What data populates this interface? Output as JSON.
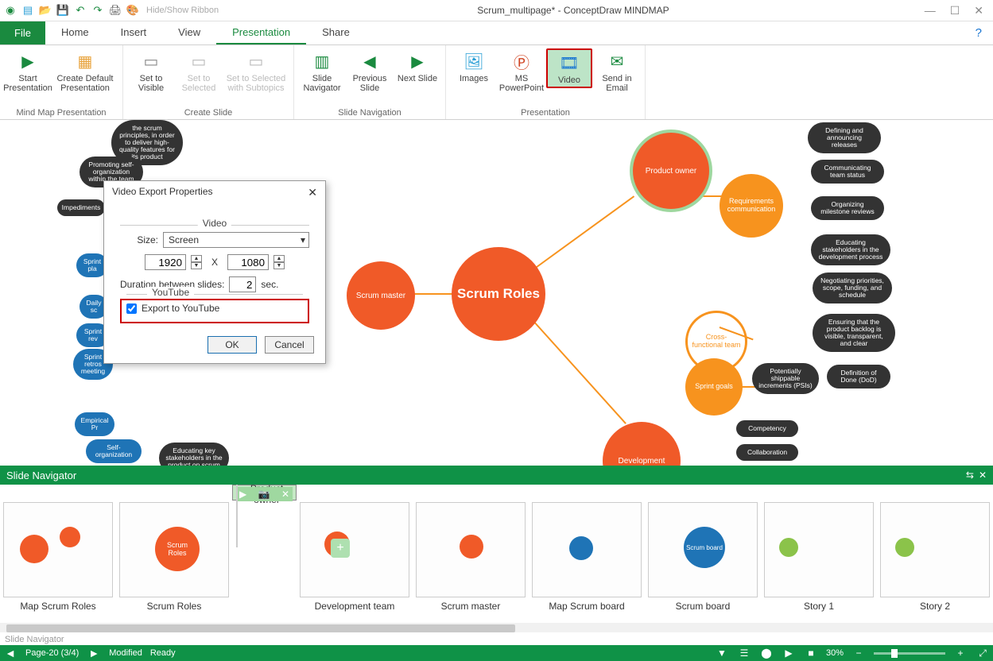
{
  "title": "Scrum_multipage* - ConceptDraw MINDMAP",
  "qat": {
    "hide_show": "Hide/Show Ribbon"
  },
  "tabs": {
    "file": "File",
    "home": "Home",
    "insert": "Insert",
    "view": "View",
    "presentation": "Presentation",
    "share": "Share"
  },
  "ribbon": {
    "groups": {
      "mindmap": "Mind Map Presentation",
      "createslide": "Create Slide",
      "slidenav": "Slide Navigation",
      "presentation": "Presentation"
    },
    "buttons": {
      "start": "Start Presentation",
      "createdefault": "Create Default Presentation",
      "settovisible": "Set to Visible",
      "settoselected": "Set to Selected",
      "settoselectedsub": "Set to Selected with Subtopics",
      "slidenavigator": "Slide Navigator",
      "prevslide": "Previous Slide",
      "nextslide": "Next Slide",
      "images": "Images",
      "mspp": "MS PowerPoint",
      "video": "Video",
      "sendemail": "Send in Email"
    }
  },
  "nodes": {
    "scrumroles_center": "Scrum Roles",
    "scrum_master": "Scrum master",
    "product_owner": "Product owner",
    "development": "Development",
    "req_comm": "Requirements communication",
    "cross_team": "Cross-functional team",
    "sprint_goals": "Sprint goals",
    "psi": "Potentially shippable increments (PSIs)",
    "dod": "Definition of Done (DoD)",
    "competency": "Competency",
    "collaboration": "Collaboration",
    "defining": "Defining and announcing releases",
    "comm_status": "Communicating team status",
    "org_reviews": "Organizing milestone reviews",
    "edu_stake": "Educating stakeholders in the development process",
    "negotiating": "Negotiating priorities, scope, funding, and schedule",
    "ensuring": "Ensuring that the product backlog is visible, transparent, and clear",
    "scrum_principles": "the scrum principles, in order to deliver high-quality features for its product",
    "promoting": "Promoting self-organization within the team",
    "impediments": "Impediments",
    "edu_key": "Educating key stakeholders in the product on scrum",
    "self_org": "Self-organization",
    "empirical": "Empirical Pr",
    "sprint_plan": "Sprint pla",
    "daily": "Daily sc",
    "sprint_rev": "Sprint rev",
    "sprint_retro": "Sprint retros meeting"
  },
  "dialog": {
    "title": "Video Export Properties",
    "video_legend": "Video",
    "size_label": "Size:",
    "size_value": "Screen",
    "width": "1920",
    "height": "1080",
    "x": "X",
    "duration_label": "Duration between slides:",
    "duration_value": "2",
    "sec": "sec.",
    "youtube_legend": "YouTube",
    "export_youtube": "Export to YouTube",
    "ok": "OK",
    "cancel": "Cancel"
  },
  "navigator": {
    "title": "Slide Navigator",
    "slides": [
      "Map Scrum Roles",
      "Scrum Roles",
      "Product owner",
      "Development team",
      "Scrum master",
      "Map Scrum board",
      "Scrum board",
      "Story 1",
      "Story 2"
    ]
  },
  "status": {
    "page": "Page-20 (3/4)",
    "modified": "Modified",
    "ready": "Ready",
    "zoom": "30%"
  }
}
